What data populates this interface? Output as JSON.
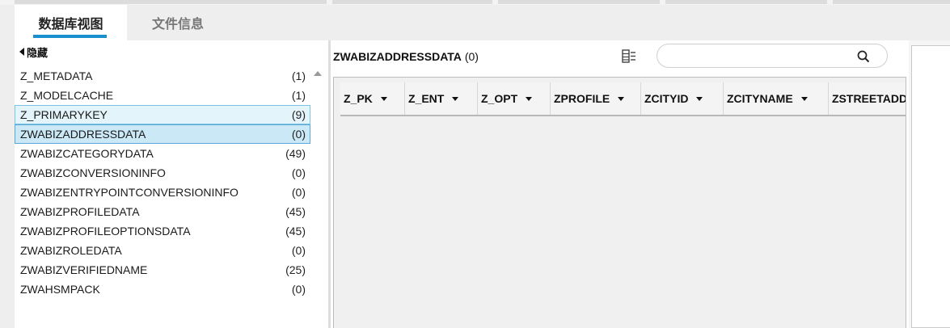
{
  "tabs": [
    {
      "label": "数据库视图",
      "active": true
    },
    {
      "label": "文件信息",
      "active": false
    }
  ],
  "sidebar": {
    "hide_label": "隐藏",
    "items": [
      {
        "name": "Z_METADATA",
        "count": "(1)"
      },
      {
        "name": "Z_MODELCACHE",
        "count": "(1)"
      },
      {
        "name": "Z_PRIMARYKEY",
        "count": "(9)"
      },
      {
        "name": "ZWABIZADDRESSDATA",
        "count": "(0)"
      },
      {
        "name": "ZWABIZCATEGORYDATA",
        "count": "(49)"
      },
      {
        "name": "ZWABIZCONVERSIONINFO",
        "count": "(0)"
      },
      {
        "name": "ZWABIZENTRYPOINTCONVERSIONINFO",
        "count": "(0)"
      },
      {
        "name": "ZWABIZPROFILEDATA",
        "count": "(45)"
      },
      {
        "name": "ZWABIZPROFILEOPTIONSDATA",
        "count": "(45)"
      },
      {
        "name": "ZWABIZROLEDATA",
        "count": "(0)"
      },
      {
        "name": "ZWABIZVERIFIEDNAME",
        "count": "(25)"
      },
      {
        "name": "ZWAHSMPACK",
        "count": "(0)"
      }
    ]
  },
  "main": {
    "table_name": "ZWABIZADDRESSDATA",
    "row_count": "(0)",
    "search_placeholder": "",
    "columns": [
      "Z_PK",
      "Z_ENT",
      "Z_OPT",
      "ZPROFILE",
      "ZCITYID",
      "ZCITYNAME",
      "ZSTREETADDRESS"
    ]
  },
  "icons": {
    "columns": "column-settings-icon",
    "search": "search-icon",
    "hide": "triangle-left-icon",
    "sort": "caret-down-icon"
  },
  "colors": {
    "accent": "#1a8fd0",
    "selected_row": "#cbe8f6",
    "highlight_row": "#e4f4fb"
  }
}
